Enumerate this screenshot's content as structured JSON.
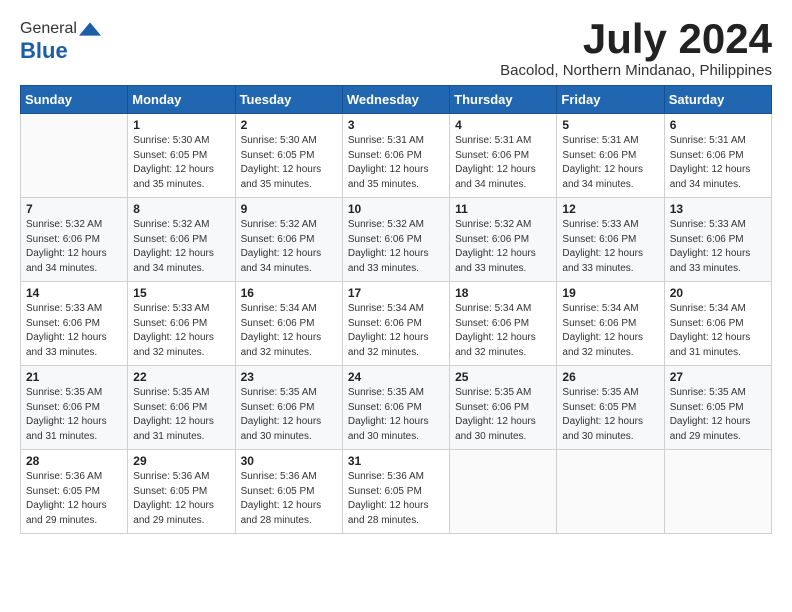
{
  "header": {
    "logo_general": "General",
    "logo_blue": "Blue",
    "month_title": "July 2024",
    "subtitle": "Bacolod, Northern Mindanao, Philippines"
  },
  "weekdays": [
    "Sunday",
    "Monday",
    "Tuesday",
    "Wednesday",
    "Thursday",
    "Friday",
    "Saturday"
  ],
  "weeks": [
    [
      {
        "day": "",
        "info": ""
      },
      {
        "day": "1",
        "info": "Sunrise: 5:30 AM\nSunset: 6:05 PM\nDaylight: 12 hours\nand 35 minutes."
      },
      {
        "day": "2",
        "info": "Sunrise: 5:30 AM\nSunset: 6:05 PM\nDaylight: 12 hours\nand 35 minutes."
      },
      {
        "day": "3",
        "info": "Sunrise: 5:31 AM\nSunset: 6:06 PM\nDaylight: 12 hours\nand 35 minutes."
      },
      {
        "day": "4",
        "info": "Sunrise: 5:31 AM\nSunset: 6:06 PM\nDaylight: 12 hours\nand 34 minutes."
      },
      {
        "day": "5",
        "info": "Sunrise: 5:31 AM\nSunset: 6:06 PM\nDaylight: 12 hours\nand 34 minutes."
      },
      {
        "day": "6",
        "info": "Sunrise: 5:31 AM\nSunset: 6:06 PM\nDaylight: 12 hours\nand 34 minutes."
      }
    ],
    [
      {
        "day": "7",
        "info": "Sunrise: 5:32 AM\nSunset: 6:06 PM\nDaylight: 12 hours\nand 34 minutes."
      },
      {
        "day": "8",
        "info": "Sunrise: 5:32 AM\nSunset: 6:06 PM\nDaylight: 12 hours\nand 34 minutes."
      },
      {
        "day": "9",
        "info": "Sunrise: 5:32 AM\nSunset: 6:06 PM\nDaylight: 12 hours\nand 34 minutes."
      },
      {
        "day": "10",
        "info": "Sunrise: 5:32 AM\nSunset: 6:06 PM\nDaylight: 12 hours\nand 33 minutes."
      },
      {
        "day": "11",
        "info": "Sunrise: 5:32 AM\nSunset: 6:06 PM\nDaylight: 12 hours\nand 33 minutes."
      },
      {
        "day": "12",
        "info": "Sunrise: 5:33 AM\nSunset: 6:06 PM\nDaylight: 12 hours\nand 33 minutes."
      },
      {
        "day": "13",
        "info": "Sunrise: 5:33 AM\nSunset: 6:06 PM\nDaylight: 12 hours\nand 33 minutes."
      }
    ],
    [
      {
        "day": "14",
        "info": "Sunrise: 5:33 AM\nSunset: 6:06 PM\nDaylight: 12 hours\nand 33 minutes."
      },
      {
        "day": "15",
        "info": "Sunrise: 5:33 AM\nSunset: 6:06 PM\nDaylight: 12 hours\nand 32 minutes."
      },
      {
        "day": "16",
        "info": "Sunrise: 5:34 AM\nSunset: 6:06 PM\nDaylight: 12 hours\nand 32 minutes."
      },
      {
        "day": "17",
        "info": "Sunrise: 5:34 AM\nSunset: 6:06 PM\nDaylight: 12 hours\nand 32 minutes."
      },
      {
        "day": "18",
        "info": "Sunrise: 5:34 AM\nSunset: 6:06 PM\nDaylight: 12 hours\nand 32 minutes."
      },
      {
        "day": "19",
        "info": "Sunrise: 5:34 AM\nSunset: 6:06 PM\nDaylight: 12 hours\nand 32 minutes."
      },
      {
        "day": "20",
        "info": "Sunrise: 5:34 AM\nSunset: 6:06 PM\nDaylight: 12 hours\nand 31 minutes."
      }
    ],
    [
      {
        "day": "21",
        "info": "Sunrise: 5:35 AM\nSunset: 6:06 PM\nDaylight: 12 hours\nand 31 minutes."
      },
      {
        "day": "22",
        "info": "Sunrise: 5:35 AM\nSunset: 6:06 PM\nDaylight: 12 hours\nand 31 minutes."
      },
      {
        "day": "23",
        "info": "Sunrise: 5:35 AM\nSunset: 6:06 PM\nDaylight: 12 hours\nand 30 minutes."
      },
      {
        "day": "24",
        "info": "Sunrise: 5:35 AM\nSunset: 6:06 PM\nDaylight: 12 hours\nand 30 minutes."
      },
      {
        "day": "25",
        "info": "Sunrise: 5:35 AM\nSunset: 6:06 PM\nDaylight: 12 hours\nand 30 minutes."
      },
      {
        "day": "26",
        "info": "Sunrise: 5:35 AM\nSunset: 6:05 PM\nDaylight: 12 hours\nand 30 minutes."
      },
      {
        "day": "27",
        "info": "Sunrise: 5:35 AM\nSunset: 6:05 PM\nDaylight: 12 hours\nand 29 minutes."
      }
    ],
    [
      {
        "day": "28",
        "info": "Sunrise: 5:36 AM\nSunset: 6:05 PM\nDaylight: 12 hours\nand 29 minutes."
      },
      {
        "day": "29",
        "info": "Sunrise: 5:36 AM\nSunset: 6:05 PM\nDaylight: 12 hours\nand 29 minutes."
      },
      {
        "day": "30",
        "info": "Sunrise: 5:36 AM\nSunset: 6:05 PM\nDaylight: 12 hours\nand 28 minutes."
      },
      {
        "day": "31",
        "info": "Sunrise: 5:36 AM\nSunset: 6:05 PM\nDaylight: 12 hours\nand 28 minutes."
      },
      {
        "day": "",
        "info": ""
      },
      {
        "day": "",
        "info": ""
      },
      {
        "day": "",
        "info": ""
      }
    ]
  ]
}
